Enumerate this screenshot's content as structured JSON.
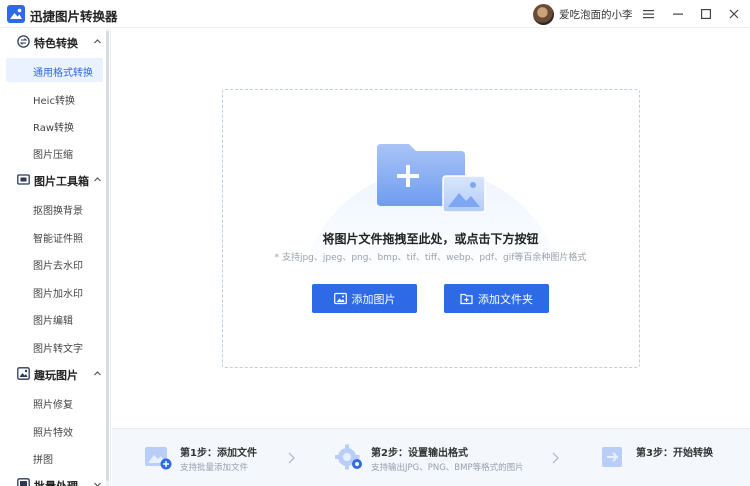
{
  "app": {
    "title": "迅捷图片转换器"
  },
  "user": {
    "name": "爱吃泡面的小李"
  },
  "window": {
    "menu_icon": "hamburger-icon",
    "min_icon": "minimize-icon",
    "max_icon": "maximize-icon",
    "close_icon": "close-icon"
  },
  "sidebar": {
    "groups": [
      {
        "label": "特色转换",
        "icon": "convert-icon",
        "items": [
          {
            "label": "通用格式转换",
            "active": true
          },
          {
            "label": "Heic转换"
          },
          {
            "label": "Raw转换"
          },
          {
            "label": "图片压缩"
          }
        ]
      },
      {
        "label": "图片工具箱",
        "icon": "toolbox-icon",
        "items": [
          {
            "label": "抠图换背景"
          },
          {
            "label": "智能证件照"
          },
          {
            "label": "图片去水印"
          },
          {
            "label": "图片加水印"
          },
          {
            "label": "图片编辑"
          },
          {
            "label": "图片转文字"
          }
        ]
      },
      {
        "label": "趣玩图片",
        "icon": "fun-image-icon",
        "items": [
          {
            "label": "照片修复"
          },
          {
            "label": "照片特效"
          },
          {
            "label": "拼图"
          }
        ]
      },
      {
        "label": "批量处理",
        "icon": "batch-icon",
        "items": []
      }
    ]
  },
  "dropzone": {
    "title": "将图片文件拖拽至此处，或点击下方按钮",
    "formats": "* 支持jpg、jpeg、png、bmp、tif、tiff、webp、pdf、gif等百余种图片格式",
    "add_image_label": "添加图片",
    "add_folder_label": "添加文件夹"
  },
  "steps": [
    {
      "title": "第1步：添加文件",
      "desc": "支持批量添加文件"
    },
    {
      "title": "第2步：设置输出格式",
      "desc": "支持输出JPG、PNG、BMP等格式的图片"
    },
    {
      "title": "第3步：开始转换",
      "desc": ""
    }
  ],
  "colors": {
    "accent": "#2e6ae6",
    "active_bg": "#eaf1ff",
    "steps_bg": "#f4f7fc"
  }
}
